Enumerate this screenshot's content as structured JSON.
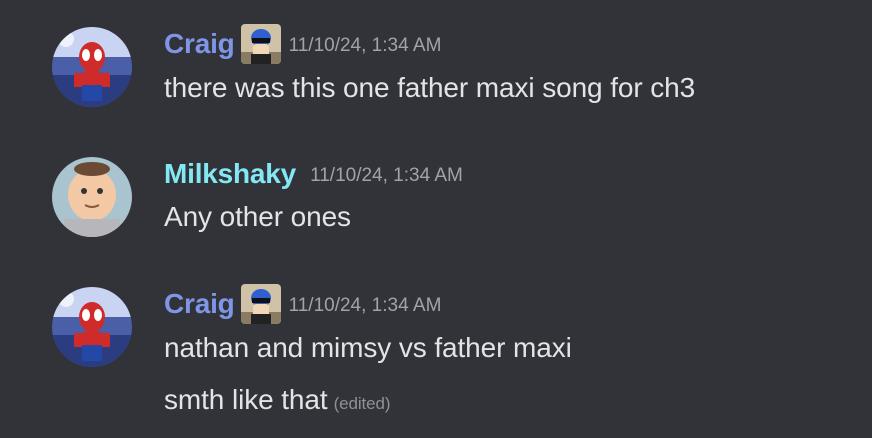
{
  "colors": {
    "background": "#323339",
    "craig_name": "#7f96e8",
    "milkshaky_name": "#84e7f4",
    "timestamp": "#a1a3aa",
    "text": "#e3e4e8"
  },
  "messages": [
    {
      "author": "Craig",
      "avatar": "spiderman-avatar",
      "badge": "role-badge-icon",
      "timestamp": "11/10/24, 1:34 AM",
      "lines": [
        "there was this one father maxi song for ch3"
      ]
    },
    {
      "author": "Milkshaky",
      "avatar": "cartoon-man-avatar",
      "timestamp": "11/10/24, 1:34 AM",
      "lines": [
        "Any other ones"
      ]
    },
    {
      "author": "Craig",
      "avatar": "spiderman-avatar",
      "badge": "role-badge-icon",
      "timestamp": "11/10/24, 1:34 AM",
      "lines": [
        "nathan and mimsy vs father maxi",
        "smth like that"
      ],
      "edited_label": "(edited)"
    }
  ]
}
